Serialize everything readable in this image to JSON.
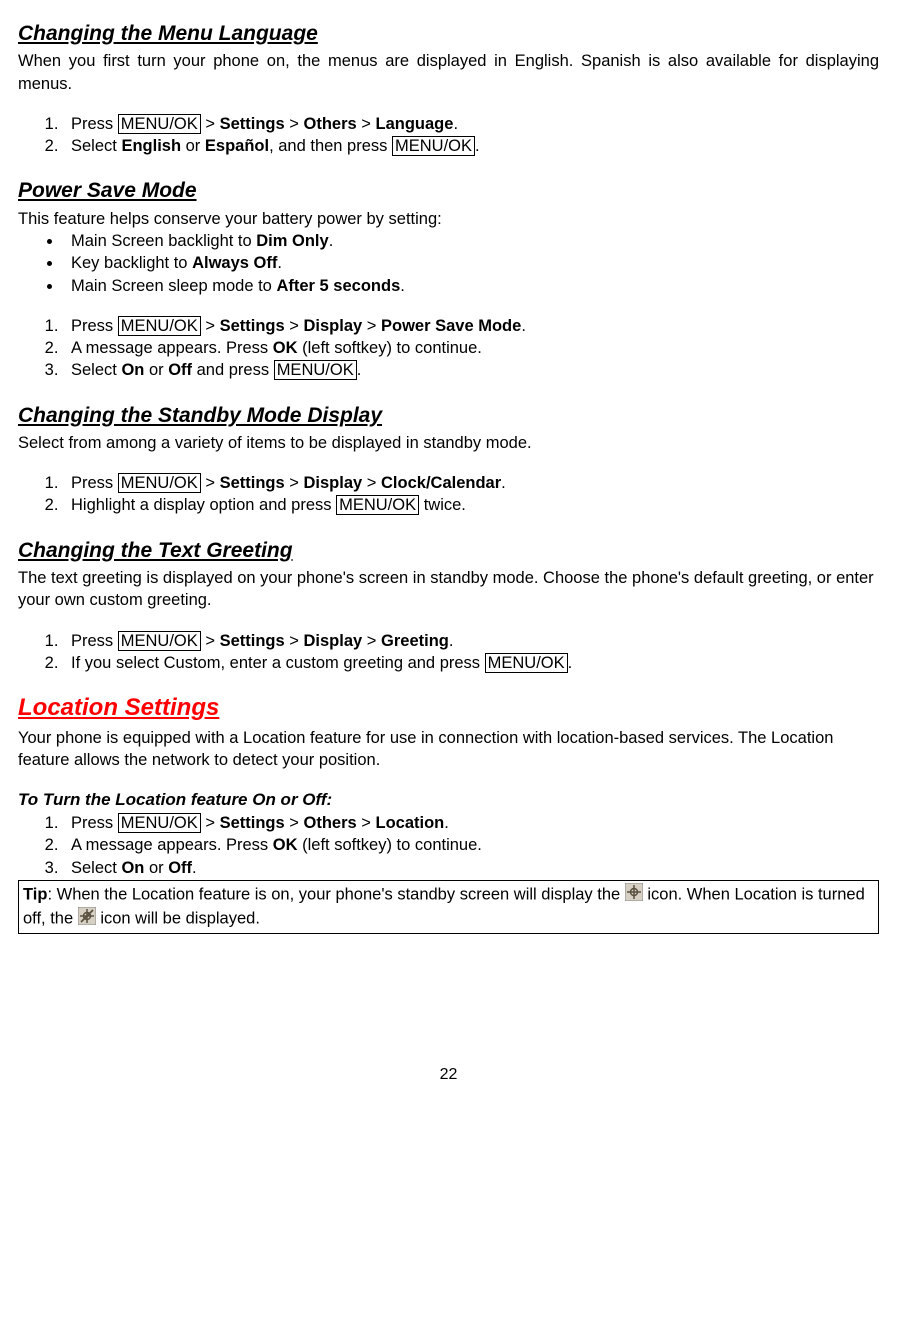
{
  "s1": {
    "title": "Changing the Menu Language",
    "intro": "When you first turn your phone on, the menus are displayed in English. Spanish is also available for displaying menus.",
    "step1_a": "Press ",
    "step1_key": "MENU/OK",
    "step1_b": " > ",
    "step1_b1": "Settings",
    "step1_c": " > ",
    "step1_c1": "Others",
    "step1_d": " > ",
    "step1_d1": "Language",
    "step1_e": ".",
    "step2_a": "Select ",
    "step2_b1": "English",
    "step2_b": " or ",
    "step2_c1": "Español",
    "step2_c": ", and then press ",
    "step2_key": "MENU/OK",
    "step2_d": "."
  },
  "s2": {
    "title": "Power Save Mode",
    "intro": "This feature helps conserve your battery power by setting:",
    "b1a": "Main Screen backlight to ",
    "b1b": "Dim Only",
    "b1c": ".",
    "b2a": "Key backlight to ",
    "b2b": "Always Off",
    "b2c": ".",
    "b3a": "Main Screen sleep mode to ",
    "b3b": "After 5 seconds",
    "b3c": ".",
    "n1a": "Press ",
    "n1key": "MENU/OK",
    "n1b": " > ",
    "n1b1": "Settings",
    "n1c": " > ",
    "n1c1": "Display",
    "n1d": " > ",
    "n1d1": "Power Save Mode",
    "n1e": ".",
    "n2a": "A message appears. Press ",
    "n2b": "OK",
    "n2c": " (left softkey) to continue.",
    "n3a": "Select ",
    "n3b": "On",
    "n3c": " or ",
    "n3d": "Off",
    "n3e": " and press ",
    "n3key": "MENU/OK",
    "n3f": "."
  },
  "s3": {
    "title": "Changing the Standby Mode Display",
    "intro": "Select from among a variety of items to be displayed in standby mode.",
    "n1a": "Press ",
    "n1key": "MENU/OK",
    "n1b": " > ",
    "n1b1": "Settings",
    "n1c": " > ",
    "n1c1": "Display",
    "n1d": " > ",
    "n1d1": "Clock/Calendar",
    "n1e": ".",
    "n2a": "Highlight a display option and press ",
    "n2key": "MENU/OK",
    "n2b": " twice."
  },
  "s4": {
    "title": "Changing the Text Greeting",
    "intro": "The text greeting is displayed on your phone's screen in standby mode. Choose the phone's default greeting, or enter your own custom greeting.",
    "n1a": "Press ",
    "n1key": "MENU/OK",
    "n1b": " > ",
    "n1b1": "Settings",
    "n1c": " > ",
    "n1c1": "Display",
    "n1d": " > ",
    "n1d1": "Greeting",
    "n1e": ".",
    "n2a": "If you select Custom, enter a custom greeting and press ",
    "n2key": "MENU/OK",
    "n2b": "."
  },
  "s5": {
    "title": "Location Settings",
    "intro": "Your phone is equipped with a Location feature for use in connection with location-based services. The Location feature allows the network to detect your position.",
    "sub": "To Turn the Location feature On or Off:",
    "n1a": "Press ",
    "n1key": "MENU/OK",
    "n1b": " > ",
    "n1b1": "Settings",
    "n1c": " > ",
    "n1c1": "Others",
    "n1d": " > ",
    "n1d1": "Location",
    "n1e": ".",
    "n2a": "A message appears. Press ",
    "n2b": "OK",
    "n2c": " (left softkey) to continue.",
    "n3a": "Select ",
    "n3b": "On",
    "n3c": " or ",
    "n3d": "Off",
    "n3e": "."
  },
  "tip": {
    "label": "Tip",
    "a": ": When the Location feature is on, your phone's standby screen will display the ",
    "b": " icon. When Location is turned off, the ",
    "c": " icon will be displayed."
  },
  "page": "22"
}
